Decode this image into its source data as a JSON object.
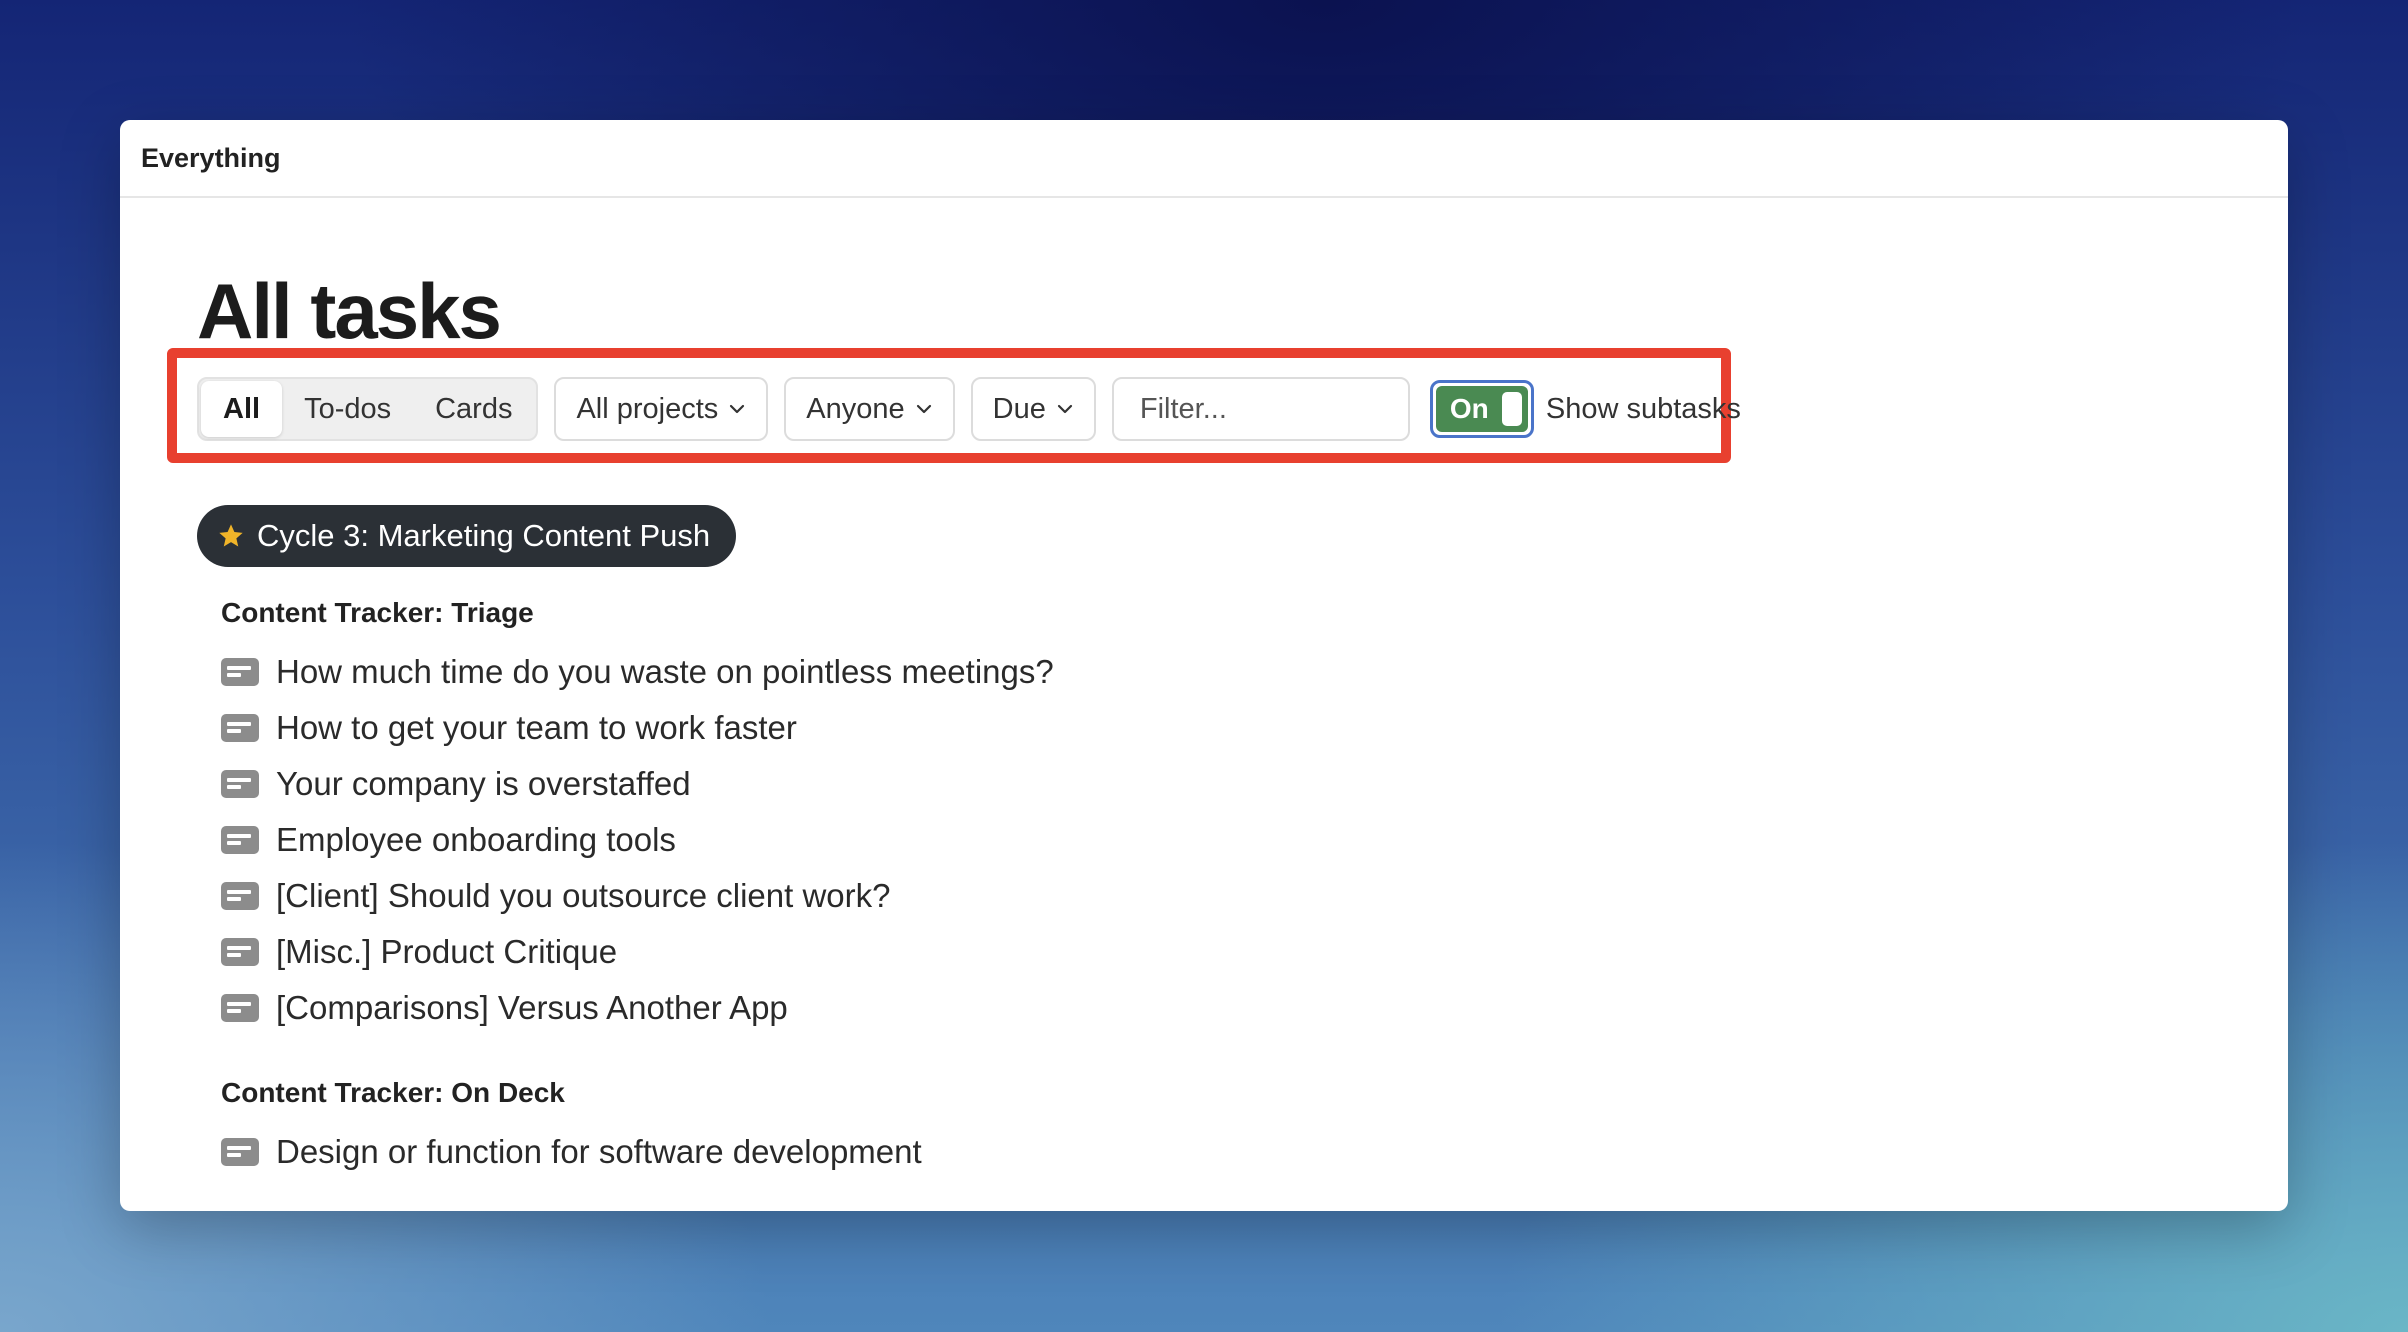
{
  "window": {
    "title": "Everything"
  },
  "page": {
    "title": "All tasks"
  },
  "toolbar": {
    "segments": [
      "All",
      "To-dos",
      "Cards"
    ],
    "active_segment": "All",
    "projects_label": "All projects",
    "assignee_label": "Anyone",
    "due_label": "Due",
    "filter_placeholder": "Filter...",
    "toggle_label": "On",
    "toggle_caption": "Show subtasks"
  },
  "cycle": {
    "label": "Cycle 3: Marketing Content Push"
  },
  "groups": [
    {
      "title": "Content Tracker: Triage",
      "items": [
        "How much time do you waste on pointless meetings?",
        "How to get your team to work faster",
        "Your company is overstaffed",
        "Employee onboarding tools",
        "[Client] Should you outsource client work?",
        "[Misc.] Product Critique",
        "[Comparisons] Versus Another App"
      ]
    },
    {
      "title": "Content Tracker: On Deck",
      "items": [
        "Design or function for software development"
      ]
    }
  ],
  "colors": {
    "highlight": "#e8402f",
    "toggle_on": "#4a8a52",
    "toggle_border": "#4a74c9",
    "pill_bg": "#2b3036",
    "star": "#f0b429",
    "card_icon": "#8c8c8c"
  },
  "icons": {
    "dropdown": "chevron-down-icon",
    "cycle": "star-icon",
    "task": "card-icon"
  }
}
